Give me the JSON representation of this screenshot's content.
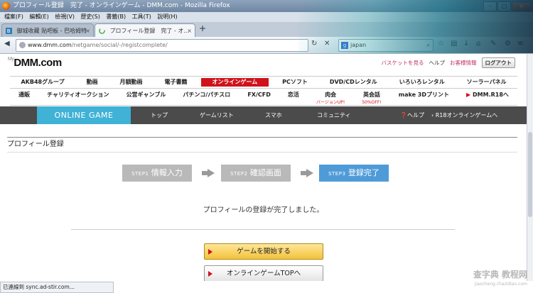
{
  "window": {
    "title": "プロフィール登録　完了 - オンラインゲーム - DMM.com - Mozilla Firefox",
    "min": "–",
    "max": "□",
    "close": "×"
  },
  "menubar": [
    "檔案(F)",
    "編輯(E)",
    "檢視(V)",
    "歷史(S)",
    "書籤(B)",
    "工具(T)",
    "說明(H)"
  ],
  "tabs": [
    {
      "label": "御城收藏 贴吧板 - 巴哈姆特",
      "active": false
    },
    {
      "label": "プロフィール登録　完了 - オ...",
      "active": true
    }
  ],
  "newtab": "+",
  "nav": {
    "url_host": "www.dmm.com",
    "url_path": "/netgame/social/-/registcomplete/",
    "search_value": "japan",
    "search_engine": "g"
  },
  "dmm": {
    "logo_prefix": "My",
    "logo": "DMM.com",
    "basket": "バスケットを見る",
    "help": "ヘルプ",
    "account": "お客様情報",
    "logout": "ログアウト"
  },
  "categories1": [
    "AKB48グループ",
    "動画",
    "月額動画",
    "電子書籍",
    "オンラインゲーム",
    "PCソフト",
    "DVD/CDレンタル",
    "いろいろレンタル",
    "ソーラーパネル"
  ],
  "categories2": [
    {
      "label": "通販",
      "sub": ""
    },
    {
      "label": "チャリティオークション",
      "sub": ""
    },
    {
      "label": "公営ギャンブル",
      "sub": ""
    },
    {
      "label": "パチンコ/パチスロ",
      "sub": ""
    },
    {
      "label": "FX/CFD",
      "sub": ""
    },
    {
      "label": "恋活",
      "sub": ""
    },
    {
      "label": "肉会",
      "sub": "バージョンUP!"
    },
    {
      "label": "英会話",
      "sub": "50%OFF!"
    },
    {
      "label": "make 3Dプリント",
      "sub": ""
    },
    {
      "label": "DMM.R18へ",
      "sub": ""
    }
  ],
  "gamebar": {
    "brand": "ONLINE GAME",
    "items": [
      "トップ",
      "ゲームリスト",
      "スマホ",
      "コミュニティ"
    ],
    "help": "ヘルプ",
    "r18": "R18オンラインゲームへ"
  },
  "page_title": "プロフィール登録",
  "steps": [
    {
      "num": "STEP1",
      "label": "情報入力",
      "state": "done"
    },
    {
      "num": "STEP2",
      "label": "確認画面",
      "state": "done"
    },
    {
      "num": "STEP3",
      "label": "登録完了",
      "state": "current"
    }
  ],
  "message": "プロフィールの登録が完了しました。",
  "buttons": {
    "start": "ゲームを開始する",
    "top": "オンラインゲームTOPへ"
  },
  "status": "已連線到 sync.ad-stir.com...",
  "watermark": {
    "main": "查字典 教程网",
    "sub": "jiaocheng.chazidian.com"
  },
  "colors": {
    "accent_red": "#d0121b",
    "online_game_blue": "#3fb2d6",
    "step_current": "#4f9bd8",
    "step_done": "#b9b9b9",
    "start_button": "#f4c23a"
  }
}
